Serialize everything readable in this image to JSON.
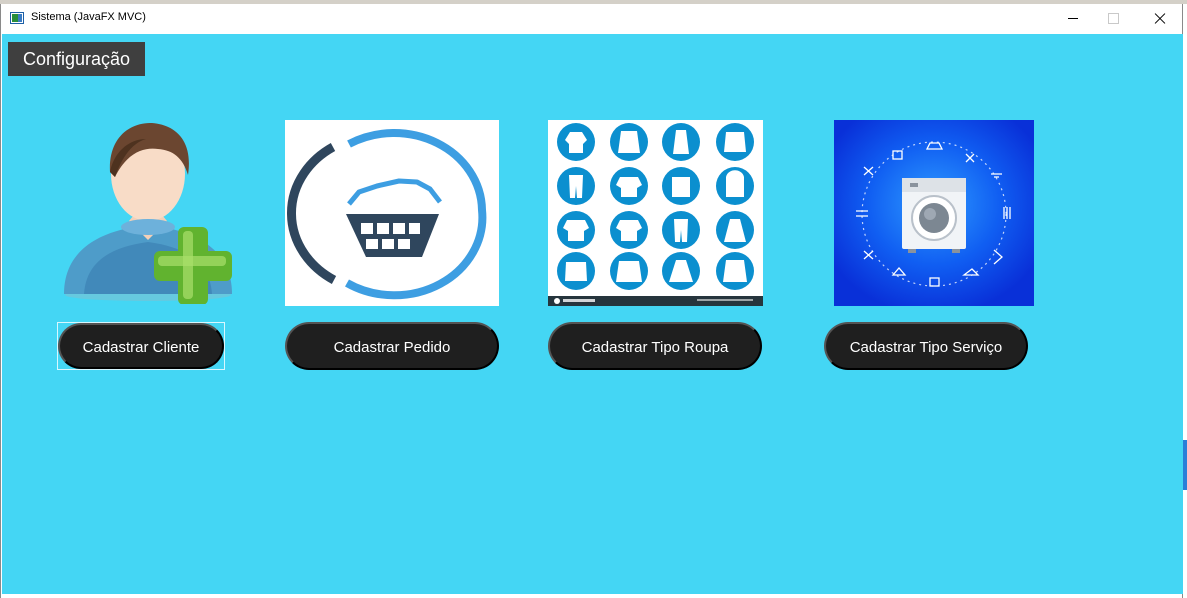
{
  "window": {
    "title": "Sistema (JavaFX MVC)"
  },
  "toolbar": {
    "config_label": "Configuração"
  },
  "actions": [
    {
      "label": "Cadastrar Cliente",
      "icon": "user-add-icon"
    },
    {
      "label": "Cadastrar Pedido",
      "icon": "laundry-basket-icon"
    },
    {
      "label": "Cadastrar Tipo Roupa",
      "icon": "clothing-grid-icon"
    },
    {
      "label": "Cadastrar Tipo Serviço",
      "icon": "washing-machine-icon"
    }
  ],
  "colors": {
    "background": "#44d6f4",
    "button": "#1f1f1f",
    "button_text": "#ffffff",
    "menu_button": "#3f3f3f"
  }
}
